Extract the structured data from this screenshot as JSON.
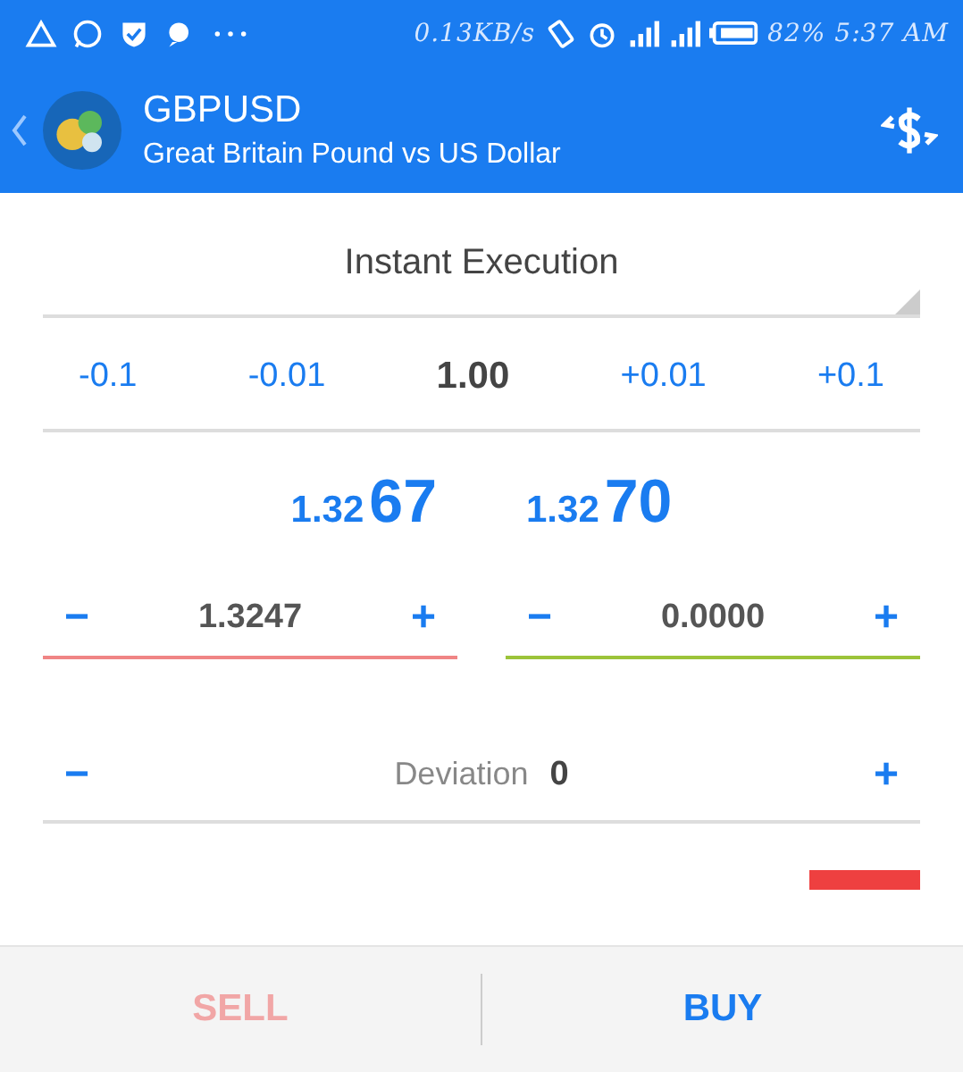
{
  "status_bar": {
    "speed": "0.13KB/s",
    "battery": "82%",
    "time": "5:37 AM"
  },
  "header": {
    "symbol": "GBPUSD",
    "description": "Great Britain Pound vs US Dollar"
  },
  "execution": {
    "label": "Instant Execution"
  },
  "volume": {
    "steps": [
      {
        "label": "-0.1",
        "kind": "step"
      },
      {
        "label": "-0.01",
        "kind": "step"
      },
      {
        "label": "1.00",
        "kind": "value"
      },
      {
        "label": "+0.01",
        "kind": "step"
      },
      {
        "label": "+0.1",
        "kind": "step"
      }
    ]
  },
  "prices": [
    {
      "small": "1.32",
      "big": "67"
    },
    {
      "small": "1.32",
      "big": "70"
    }
  ],
  "levels": [
    {
      "minus": "−",
      "value": "1.3247",
      "plus": "+",
      "color": "#f08585"
    },
    {
      "minus": "−",
      "value": "0.0000",
      "plus": "+",
      "color": "#9cc43a"
    }
  ],
  "deviation": {
    "minus": "−",
    "label": "Deviation",
    "value": "0",
    "plus": "+"
  },
  "actions": [
    {
      "label": "SELL",
      "disabled": true
    },
    {
      "label": "BUY",
      "disabled": false
    }
  ]
}
